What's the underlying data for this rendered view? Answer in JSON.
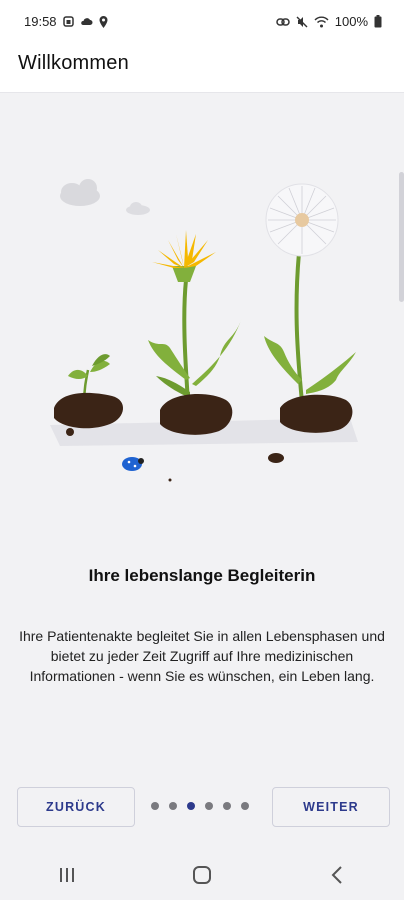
{
  "status_bar": {
    "time": "19:58",
    "battery": "100%",
    "left_icons": [
      "notification-icon",
      "cloud-icon",
      "location-icon"
    ],
    "right_icons": [
      "link-icon",
      "mute-icon",
      "wifi-icon",
      "battery-icon"
    ]
  },
  "app_bar": {
    "title": "Willkommen"
  },
  "onboarding": {
    "headline": "Ihre lebenslange Begleiterin",
    "body": "Ihre Patientenakte begleitet Sie in allen Lebensphasen und bietet zu jeder Zeit Zugriff auf Ihre medizinischen Informationen - wenn Sie es wünschen, ein Leben lang.",
    "illustration_icon": "dandelion-growth-illustration",
    "page_count": 6,
    "current_page": 3
  },
  "navigation": {
    "back_label": "ZURÜCK",
    "next_label": "WEITER"
  },
  "colors": {
    "accent": "#2d3a8c",
    "background": "#f2f2f4",
    "plant_green": "#7fae3a",
    "soil": "#3b2416",
    "flower_yellow": "#f5b800",
    "ladybug": "#1f63d1"
  },
  "system_nav": {
    "icons": [
      "recent-apps-icon",
      "home-icon",
      "back-icon"
    ]
  }
}
